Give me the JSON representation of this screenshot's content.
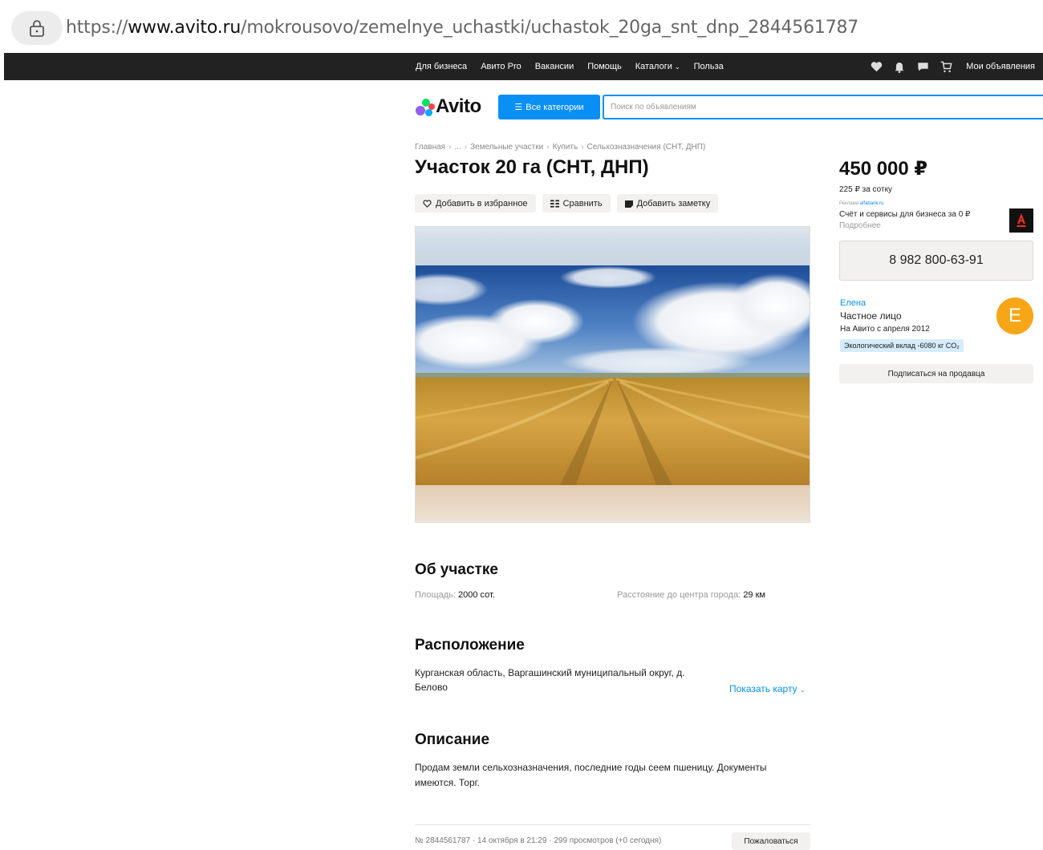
{
  "browser": {
    "url_prefix": "https://",
    "url_host": "www.avito.ru",
    "url_path": "/mokrousovo/zemelnye_uchastki/uchastok_20ga_snt_dnp_2844561787"
  },
  "topnav": {
    "links": [
      "Для бизнеса",
      "Авито Pro",
      "Вакансии",
      "Помощь",
      "Каталоги",
      "Польза"
    ],
    "my_ads": "Мои объявления"
  },
  "header": {
    "logo_text": "Avito",
    "categories_button": "Все категории",
    "search_placeholder": "Поиск по объявлениям"
  },
  "breadcrumb": [
    "Главная",
    "...",
    "Земельные участки",
    "Купить",
    "Сельхозназначения (СНТ, ДНП)"
  ],
  "listing": {
    "title": "Участок 20 га (СНТ, ДНП)",
    "actions": {
      "favorite": "Добавить в избранное",
      "compare": "Сравнить",
      "note": "Добавить заметку"
    }
  },
  "sidebar": {
    "price": "450 000 ₽",
    "price_per_sotka": "225 ₽ за сотку",
    "ad_label": "Реклама",
    "ad_link": "alfabank.ru",
    "ad_text": "Счёт и сервисы для бизнеса за 0 ₽",
    "ad_more": "Подробнее",
    "phone": "8 982 800-63-91",
    "seller_name": "Елена",
    "seller_type": "Частное лицо",
    "seller_since": "На Авито с апреля 2012",
    "eco_badge": "Экологический вклад -6080 кг CO₂",
    "avatar_letter": "Е",
    "subscribe": "Подписаться на продавца"
  },
  "about": {
    "title": "Об участке",
    "area_label": "Площадь:",
    "area_value": "2000 сот.",
    "distance_label": "Расстояние до центра города:",
    "distance_value": "29 км"
  },
  "location": {
    "title": "Расположение",
    "address": "Курганская область, Варгашинский муниципальный округ, д. Белово",
    "map_link": "Показать карту"
  },
  "description": {
    "title": "Описание",
    "text": "Продам земли сельхозназначения, последние годы сеем пшеницу. Документы имеются. Торг."
  },
  "footer": {
    "meta": "№ 2844561787 · 14 октября в 21:29 · 299 просмотров (+0 сегодня)",
    "report": "Пожаловаться"
  },
  "colors": {
    "accent": "#0a8ff5",
    "nav_bg": "#222222",
    "avatar_bg": "#f6a617"
  }
}
